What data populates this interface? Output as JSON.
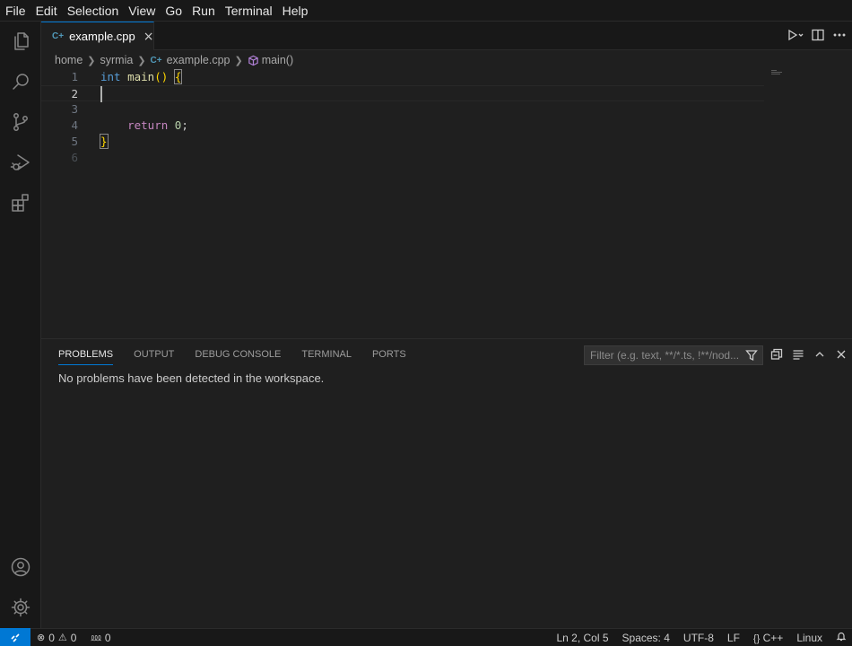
{
  "menu": [
    "File",
    "Edit",
    "Selection",
    "View",
    "Go",
    "Run",
    "Terminal",
    "Help"
  ],
  "activity_bar": {
    "top": [
      "explorer-icon",
      "search-icon",
      "source-control-icon",
      "run-debug-icon",
      "extensions-icon"
    ],
    "bottom": [
      "accounts-icon",
      "manage-gear-icon"
    ]
  },
  "tab": {
    "label": "example.cpp",
    "icon_text": "C+",
    "close": "×"
  },
  "breadcrumb": {
    "items": [
      "home",
      "syrmia",
      "example.cpp",
      "main()"
    ],
    "file_icon_text": "C+"
  },
  "editor": {
    "line_numbers": [
      "1",
      "2",
      "3",
      "4",
      "5",
      "6"
    ],
    "current_line": 2,
    "line1": {
      "type": "int",
      "fn": "main",
      "paren": "()",
      "brace": "{"
    },
    "line4": {
      "indent": "    ",
      "kw": "return",
      "num": "0",
      "semi": ";"
    },
    "line5": {
      "brace": "}"
    }
  },
  "panel": {
    "tabs": [
      "PROBLEMS",
      "OUTPUT",
      "DEBUG CONSOLE",
      "TERMINAL",
      "PORTS"
    ],
    "active_tab": "PROBLEMS",
    "filter_placeholder": "Filter (e.g. text, **/*.ts, !**/nod...",
    "message": "No problems have been detected in the workspace."
  },
  "status": {
    "errors": "0",
    "warnings": "0",
    "ports": "0",
    "position": "Ln 2, Col 5",
    "spaces": "Spaces: 4",
    "encoding": "UTF-8",
    "eol": "LF",
    "language_icon": "{}",
    "language": "C++",
    "platform": "Linux"
  },
  "colors": {
    "accent": "#0078d4",
    "background": "#1f1f1f",
    "chrome": "#181818"
  }
}
